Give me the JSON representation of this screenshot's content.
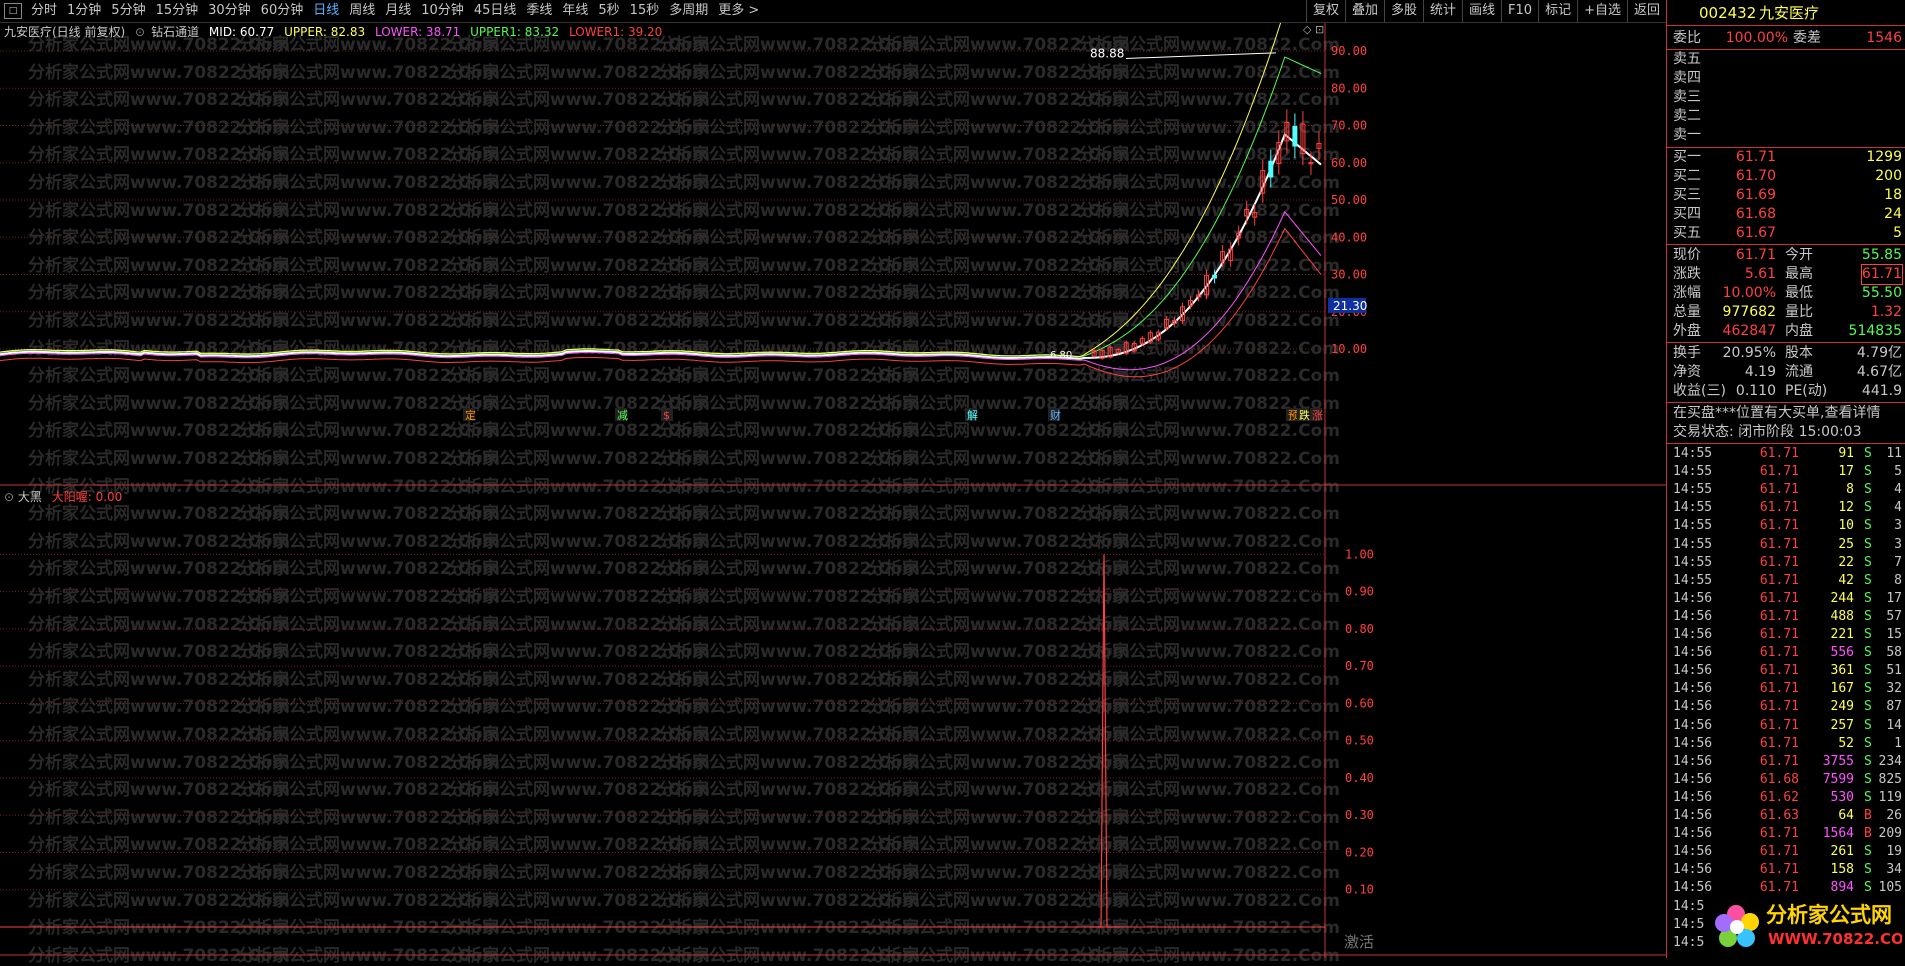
{
  "toolbar": {
    "periods": [
      "分时",
      "1分钟",
      "5分钟",
      "15分钟",
      "30分钟",
      "60分钟",
      "日线",
      "周线",
      "月线",
      "10分钟",
      "45日线",
      "季线",
      "年线",
      "5秒",
      "15秒",
      "多周期",
      "更多 >"
    ],
    "active_period": "日线",
    "right_buttons": [
      "复权",
      "叠加",
      "多股",
      "统计",
      "画线",
      "F10",
      "标记",
      "+自选",
      "返回"
    ]
  },
  "main_chart": {
    "title": "九安医疗(日线 前复权)",
    "indicator": "钻石通道",
    "mid_label": "MID: 60.77",
    "upper_label": "UPPER: 82.83",
    "lower_label": "LOWER: 38.71",
    "upper1_label": "UPPER1: 83.32",
    "lower1_label": "LOWER1: 39.20",
    "y_ticks": [
      "90.00",
      "80.00",
      "70.00",
      "60.00",
      "50.00",
      "40.00",
      "30.00",
      "20.00",
      "10.00"
    ],
    "high_marker": "88.88",
    "low_marker": "6.80",
    "price_tag": "21.30",
    "event_marks": [
      "定",
      "减",
      "$",
      "解",
      "财",
      "预",
      "跌",
      "涨"
    ]
  },
  "sub_chart": {
    "title": "大黑",
    "indicator_label": "大阳喔: 0.00",
    "y_ticks": [
      "1.00",
      "0.90",
      "0.80",
      "0.70",
      "0.60",
      "0.50",
      "0.40",
      "0.30",
      "0.20",
      "0.10"
    ],
    "overlay_text": "激活"
  },
  "panel": {
    "code": "002432",
    "name": "九安医疗",
    "webi_label": "委比",
    "webi_value": "100.00%",
    "weicha_label": "委差",
    "weicha_value": "1546",
    "sell_levels": [
      {
        "label": "卖五"
      },
      {
        "label": "卖四"
      },
      {
        "label": "卖三"
      },
      {
        "label": "卖二"
      },
      {
        "label": "卖一"
      }
    ],
    "buy_levels": [
      {
        "label": "买一",
        "price": "61.71",
        "vol": "1299"
      },
      {
        "label": "买二",
        "price": "61.70",
        "vol": "200"
      },
      {
        "label": "买三",
        "price": "61.69",
        "vol": "18"
      },
      {
        "label": "买四",
        "price": "61.68",
        "vol": "24"
      },
      {
        "label": "买五",
        "price": "61.67",
        "vol": "5"
      }
    ],
    "quote_rows": [
      {
        "k1": "现价",
        "v1": "61.71",
        "k2": "今开",
        "v2": "55.85"
      },
      {
        "k1": "涨跌",
        "v1": "5.61",
        "k2": "最高",
        "v2": "61.71"
      },
      {
        "k1": "涨幅",
        "v1": "10.00%",
        "k2": "最低",
        "v2": "55.50"
      },
      {
        "k1": "总量",
        "v1": "977682",
        "k2": "量比",
        "v2": "1.32"
      },
      {
        "k1": "外盘",
        "v1": "462847",
        "k2": "内盘",
        "v2": "514835"
      }
    ],
    "fund_rows": [
      {
        "k1": "换手",
        "v1": "20.95%",
        "k2": "股本",
        "v2": "4.79亿"
      },
      {
        "k1": "净资",
        "v1": "4.19",
        "k2": "流通",
        "v2": "4.67亿"
      },
      {
        "k1": "收益(三)",
        "v1": "0.110",
        "k2": "PE(动)",
        "v2": "441.9"
      }
    ],
    "notice": "在买盘***位置有大买单,查看详情",
    "trade_status": "交易状态: 闭市阶段 15:00:03",
    "ticks": [
      {
        "t": "14:55",
        "p": "61.71",
        "v": "91",
        "d": "S",
        "n": "11"
      },
      {
        "t": "14:55",
        "p": "61.71",
        "v": "17",
        "d": "S",
        "n": "5"
      },
      {
        "t": "14:55",
        "p": "61.71",
        "v": "8",
        "d": "S",
        "n": "4"
      },
      {
        "t": "14:55",
        "p": "61.71",
        "v": "12",
        "d": "S",
        "n": "4"
      },
      {
        "t": "14:55",
        "p": "61.71",
        "v": "10",
        "d": "S",
        "n": "3"
      },
      {
        "t": "14:55",
        "p": "61.71",
        "v": "25",
        "d": "S",
        "n": "3"
      },
      {
        "t": "14:55",
        "p": "61.71",
        "v": "22",
        "d": "S",
        "n": "7"
      },
      {
        "t": "14:55",
        "p": "61.71",
        "v": "42",
        "d": "S",
        "n": "8"
      },
      {
        "t": "14:56",
        "p": "61.71",
        "v": "244",
        "d": "S",
        "n": "17"
      },
      {
        "t": "14:56",
        "p": "61.71",
        "v": "488",
        "d": "S",
        "n": "57"
      },
      {
        "t": "14:56",
        "p": "61.71",
        "v": "221",
        "d": "S",
        "n": "15"
      },
      {
        "t": "14:56",
        "p": "61.71",
        "v": "556",
        "d": "S",
        "n": "58"
      },
      {
        "t": "14:56",
        "p": "61.71",
        "v": "361",
        "d": "S",
        "n": "51"
      },
      {
        "t": "14:56",
        "p": "61.71",
        "v": "167",
        "d": "S",
        "n": "32"
      },
      {
        "t": "14:56",
        "p": "61.71",
        "v": "249",
        "d": "S",
        "n": "87"
      },
      {
        "t": "14:56",
        "p": "61.71",
        "v": "257",
        "d": "S",
        "n": "14"
      },
      {
        "t": "14:56",
        "p": "61.71",
        "v": "52",
        "d": "S",
        "n": "1"
      },
      {
        "t": "14:56",
        "p": "61.71",
        "v": "3755",
        "d": "S",
        "n": "234"
      },
      {
        "t": "14:56",
        "p": "61.68",
        "v": "7599",
        "d": "S",
        "n": "825"
      },
      {
        "t": "14:56",
        "p": "61.62",
        "v": "530",
        "d": "S",
        "n": "119"
      },
      {
        "t": "14:56",
        "p": "61.63",
        "v": "64",
        "d": "B",
        "n": "26"
      },
      {
        "t": "14:56",
        "p": "61.71",
        "v": "1564",
        "d": "B",
        "n": "209"
      },
      {
        "t": "14:56",
        "p": "61.71",
        "v": "261",
        "d": "S",
        "n": "19"
      },
      {
        "t": "14:56",
        "p": "61.71",
        "v": "158",
        "d": "S",
        "n": "34"
      },
      {
        "t": "14:56",
        "p": "61.71",
        "v": "894",
        "d": "S",
        "n": "105"
      },
      {
        "t": "14:5",
        "p": "",
        "v": "",
        "d": "",
        "n": ""
      },
      {
        "t": "14:5",
        "p": "",
        "v": "",
        "d": "",
        "n": ""
      },
      {
        "t": "14:5",
        "p": "",
        "v": "",
        "d": "",
        "n": ""
      }
    ]
  },
  "watermark": "分析家公式网www.70822.Com",
  "logo": {
    "title": "分析家公式网",
    "url": "WWW.70822.COM"
  },
  "colors": {
    "up": "#ff4040",
    "down": "#54fcfc",
    "yellow": "#ffff54",
    "green": "#54fc54",
    "magenta": "#ff54ff",
    "white": "#ffffff",
    "grid": "#781e1e"
  }
}
